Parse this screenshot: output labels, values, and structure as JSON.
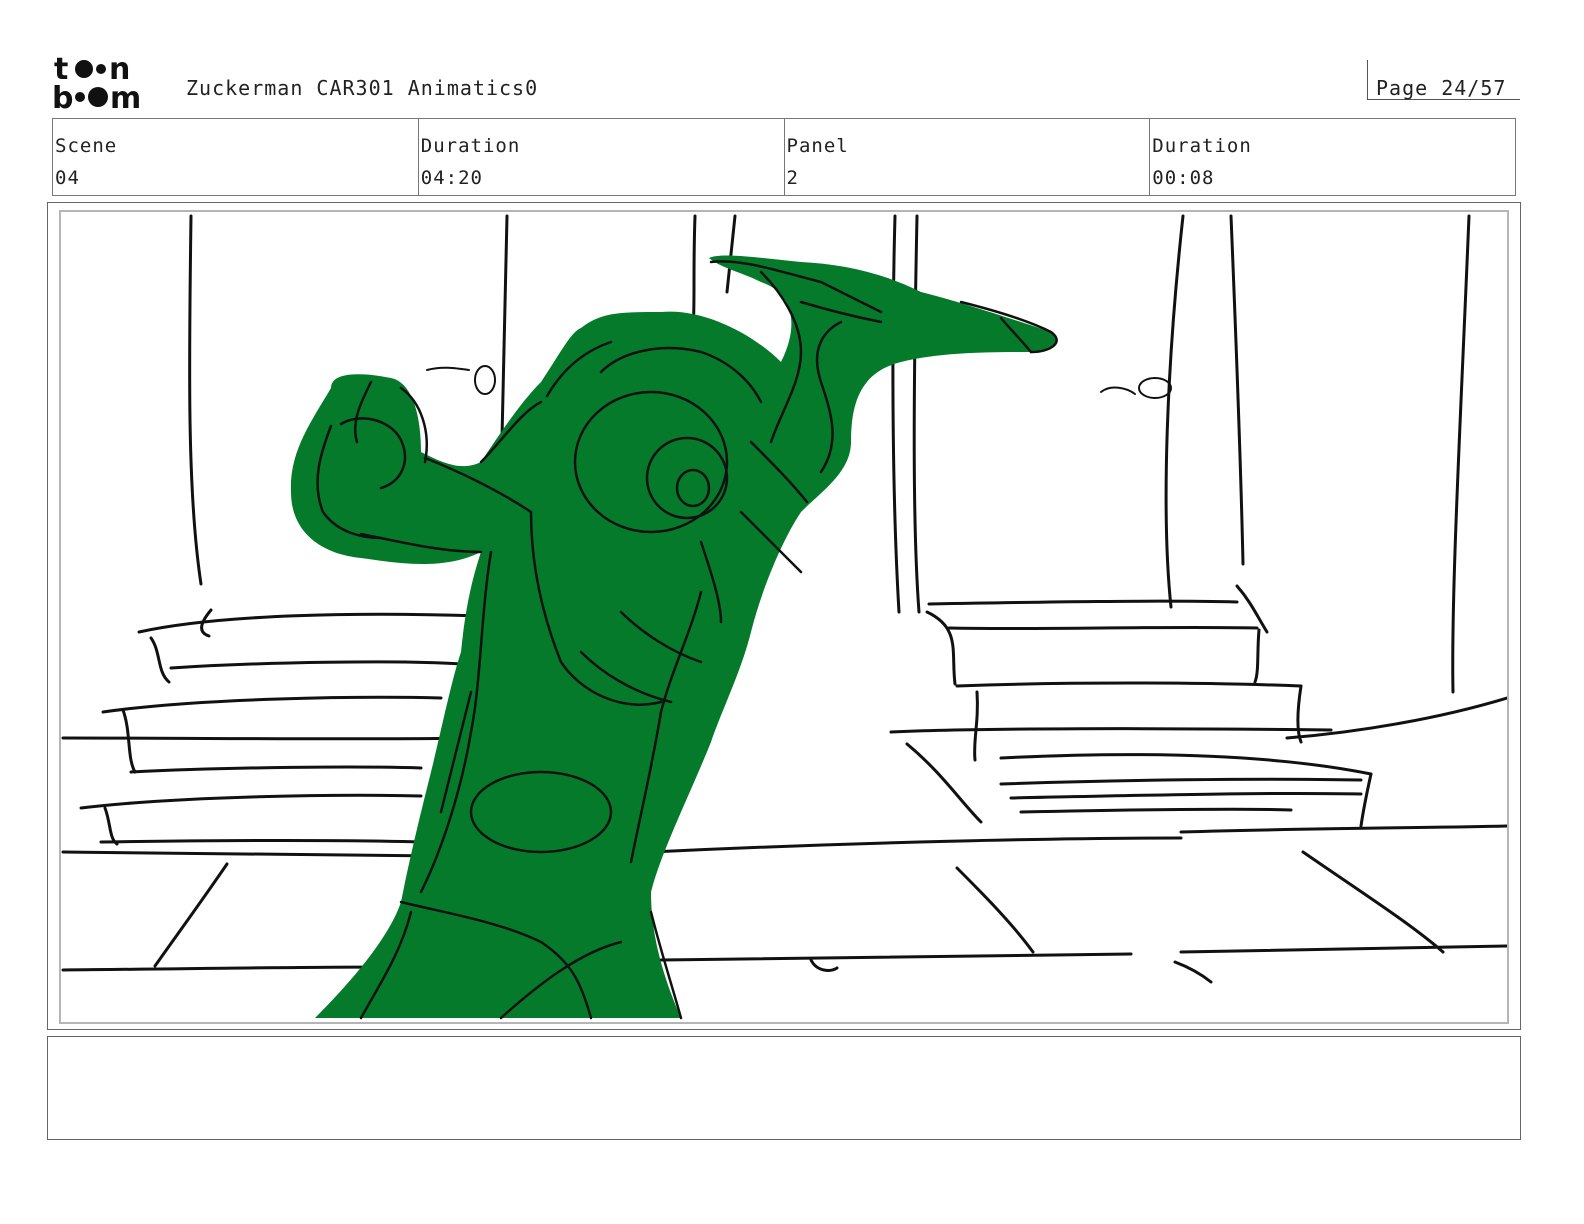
{
  "header": {
    "logo_text": "toon boom",
    "project_title": "Zuckerman CAR301 Animatics0",
    "page_label": "Page 24/57"
  },
  "info": {
    "scene_label": "Scene",
    "scene_value": "04",
    "scene_duration_label": "Duration",
    "scene_duration_value": "04:20",
    "panel_label": "Panel",
    "panel_value": "2",
    "panel_duration_label": "Duration",
    "panel_duration_value": "00:08"
  },
  "panel": {
    "sketch_fill_color": "#047a2a",
    "line_color": "#111111"
  },
  "notes": {
    "text": ""
  }
}
